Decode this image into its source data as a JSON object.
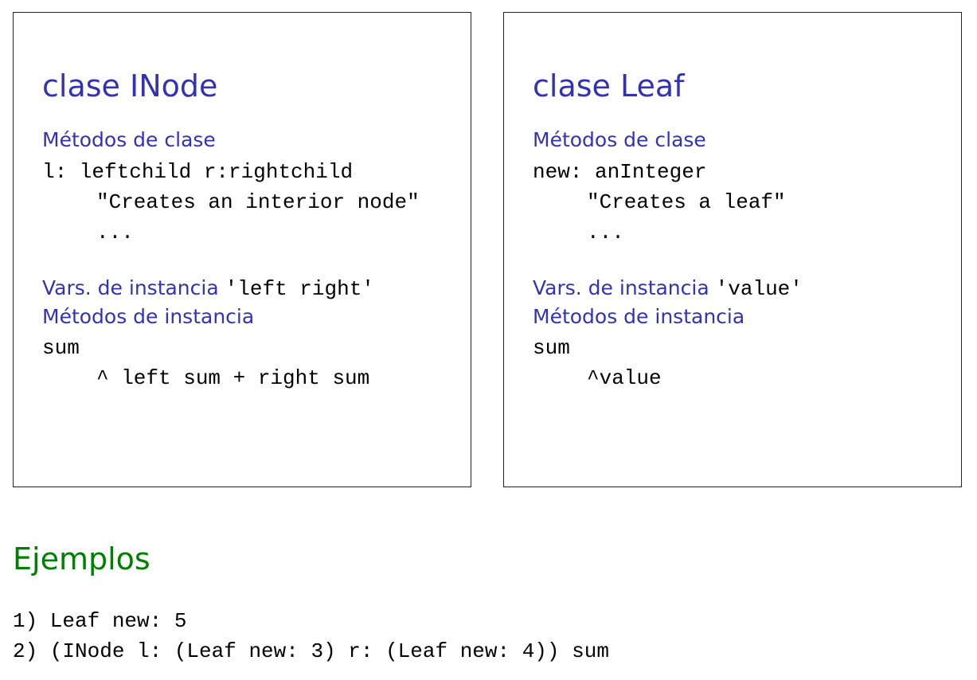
{
  "inode_box": {
    "title": "clase INode",
    "class_methods_label": "Métodos de clase",
    "class_method_signature": "l: leftchild r:rightchild",
    "class_method_comment": "\"Creates an interior node\"",
    "class_method_body": "...",
    "instance_vars_label": "Vars. de instancia",
    "instance_vars_value": "'left right'",
    "instance_methods_label": "Métodos de instancia",
    "instance_method_name": "sum",
    "instance_method_body": "^ left sum + right sum"
  },
  "leaf_box": {
    "title": "clase Leaf",
    "class_methods_label": "Métodos de clase",
    "class_method_signature": "new: anInteger",
    "class_method_comment": "\"Creates a leaf\"",
    "class_method_body": "...",
    "instance_vars_label": "Vars. de instancia",
    "instance_vars_value": "'value'",
    "instance_methods_label": "Métodos de instancia",
    "instance_method_name": "sum",
    "instance_method_body": "^value"
  },
  "examples": {
    "title": "Ejemplos",
    "lines": [
      "1) Leaf new: 5",
      "2) (INode l: (Leaf new: 3) r: (Leaf new: 4)) sum"
    ]
  }
}
